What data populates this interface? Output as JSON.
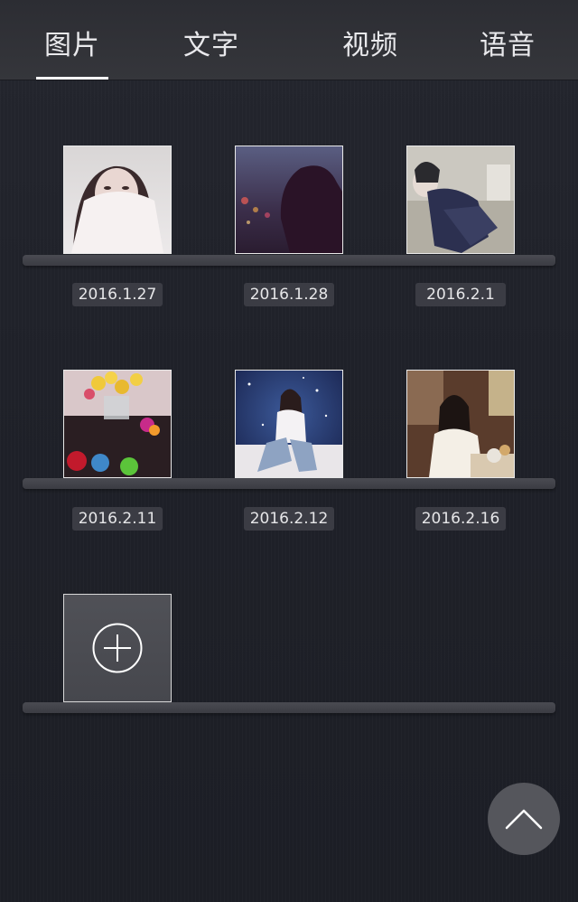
{
  "tabs": [
    {
      "label": "图片",
      "active": true
    },
    {
      "label": "文字",
      "active": false
    },
    {
      "label": "视频",
      "active": false
    },
    {
      "label": "语音",
      "active": false
    }
  ],
  "photos": [
    {
      "date": "2016.1.27",
      "subject": "woman-with-fur-scarf"
    },
    {
      "date": "2016.1.28",
      "subject": "silhouette-city-night"
    },
    {
      "date": "2016.2.1",
      "subject": "woman-lace-dress-sofa"
    },
    {
      "date": "2016.2.11",
      "subject": "flowers-roses-box"
    },
    {
      "date": "2016.2.12",
      "subject": "woman-starry-backdrop"
    },
    {
      "date": "2016.2.16",
      "subject": "woman-restaurant-table"
    }
  ],
  "add_tile": {
    "icon": "plus-circle-icon"
  },
  "scroll_top": {
    "icon": "chevron-up-icon"
  },
  "colors": {
    "background": "#1f2129",
    "tabbar": "#323338",
    "shelf": "#42434a",
    "date_badge": "#3b3c44",
    "text": "#e9e9ec"
  }
}
